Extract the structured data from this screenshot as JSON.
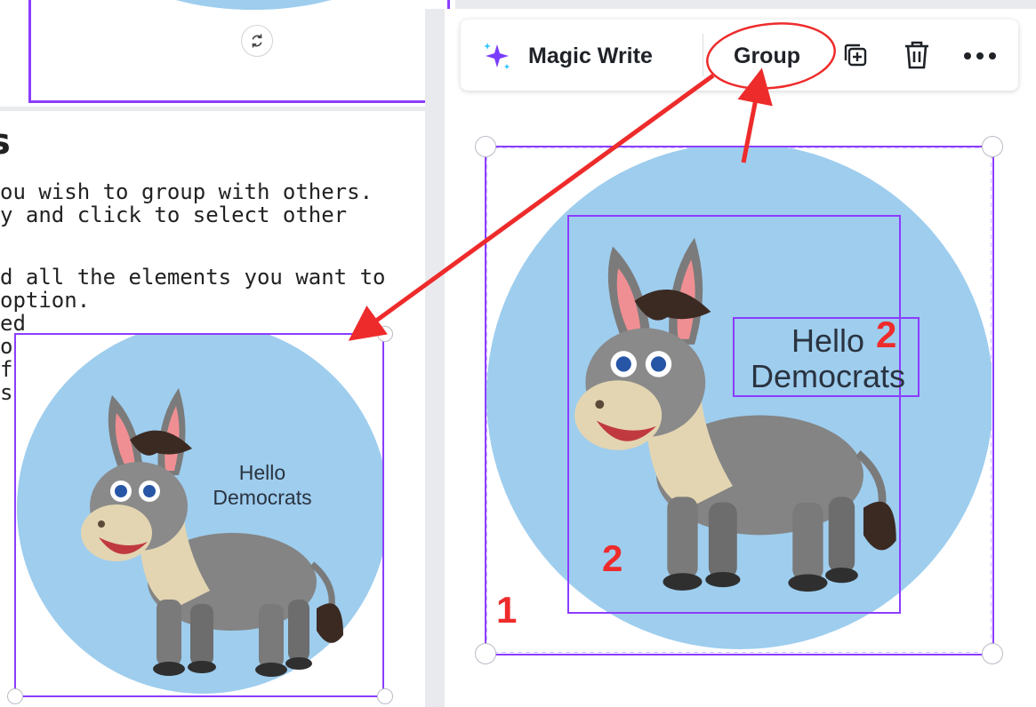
{
  "instructions": {
    "heading": "s",
    "lines": [
      "ou wish to group with others.",
      "y and click to select other",
      "d all the elements you want to",
      "option.",
      "ed",
      "ox.",
      "f",
      "s"
    ]
  },
  "toolbar": {
    "magic_write_label": "Magic Write",
    "group_label": "Group",
    "icons": [
      "sparkle-icon",
      "duplicate-icon",
      "trash-icon",
      "more-icon"
    ]
  },
  "canvas_left": {
    "text_line1": "Hello",
    "text_line2": "Democrats"
  },
  "canvas_right": {
    "text_line1": "Hello",
    "text_line2": "Democrats",
    "annotations": [
      "2",
      "2",
      "1"
    ]
  },
  "colors": {
    "selection": "#8b3dff",
    "annotation": "#ee2b2b",
    "circle": "#9ecdee"
  }
}
